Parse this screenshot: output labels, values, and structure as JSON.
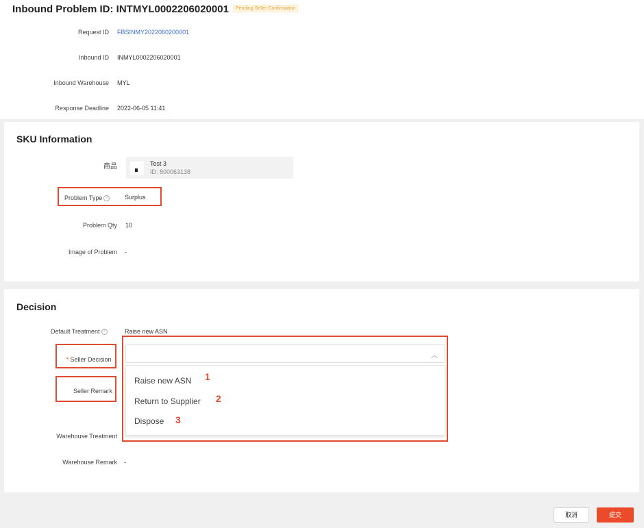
{
  "header": {
    "title": "Inbound Problem ID: INTMYL0002206020001",
    "status_badge": "Pending Seller Confirmation"
  },
  "basic_info": {
    "request_id_label": "Request ID",
    "request_id_value": "FBSINMY2022060200001",
    "inbound_id_label": "Inbound ID",
    "inbound_id_value": "INMYL0002206020001",
    "warehouse_label": "Inbound Warehouse",
    "warehouse_value": "MYL",
    "deadline_label": "Response Deadline",
    "deadline_value": "2022-06-05 11:41"
  },
  "sku": {
    "section_title": "SKU Information",
    "product_label": "商品",
    "product_name": "Test 3",
    "product_id": "ID: 800063138",
    "problem_type_label": "Problem Type",
    "problem_type_value": "Surplus",
    "problem_qty_label": "Problem Qty",
    "problem_qty_value": "10",
    "image_label": "Image of Problem",
    "image_value": "-"
  },
  "decision": {
    "section_title": "Decision",
    "default_treatment_label": "Default Treatment",
    "default_treatment_value": "Raise new ASN",
    "required_mark": "*",
    "seller_decision_label": "Seller Decision",
    "seller_remark_label": "Seller Remark",
    "warehouse_treatment_label": "Warehouse Treatment",
    "warehouse_remark_label": "Warehouse Remark",
    "warehouse_remark_value": "-",
    "chevron_glyph": "︿",
    "options": [
      {
        "label": "Raise new ASN",
        "marker": "1"
      },
      {
        "label": "Return to Supplier",
        "marker": "2"
      },
      {
        "label": "Dispose",
        "marker": "3"
      }
    ]
  },
  "footer": {
    "cancel_label": "取消",
    "submit_label": "提交"
  },
  "icons": {
    "info": "?"
  },
  "colors": {
    "accent": "#ec4b2b",
    "link": "#3b6fd4",
    "badge": "#e8a13a",
    "highlight": "#e04b2f"
  }
}
